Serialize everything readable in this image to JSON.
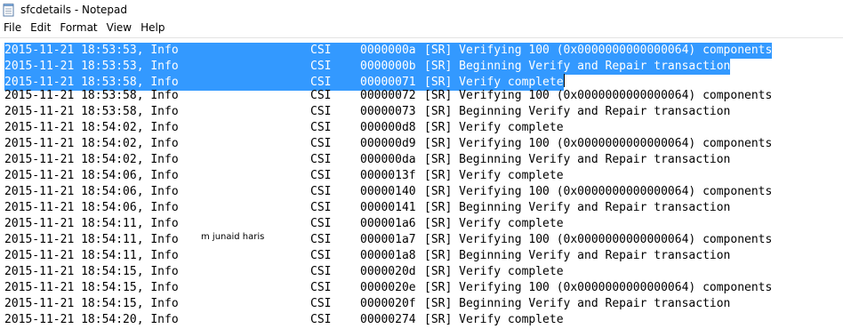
{
  "window": {
    "title": "sfcdetails - Notepad"
  },
  "menu": [
    "File",
    "Edit",
    "Format",
    "View",
    "Help"
  ],
  "watermark": "m junaid haris",
  "lines": [
    {
      "time": "2015-11-21 18:53:53, Info",
      "csi": "CSI",
      "code": "0000000a",
      "msg": "[SR] Verifying 100 (0x0000000000000064) components",
      "selected": true
    },
    {
      "time": "2015-11-21 18:53:53, Info",
      "csi": "CSI",
      "code": "0000000b",
      "msg": "[SR] Beginning Verify and Repair transaction",
      "selected": true
    },
    {
      "time": "2015-11-21 18:53:58, Info",
      "csi": "CSI",
      "code": "00000071",
      "msg": "[SR] Verify complete",
      "selected": true
    },
    {
      "time": "2015-11-21 18:53:58, Info",
      "csi": "CSI",
      "code": "00000072",
      "msg": "[SR] Verifying 100 (0x0000000000000064) components",
      "selected": false
    },
    {
      "time": "2015-11-21 18:53:58, Info",
      "csi": "CSI",
      "code": "00000073",
      "msg": "[SR] Beginning Verify and Repair transaction",
      "selected": false
    },
    {
      "time": "2015-11-21 18:54:02, Info",
      "csi": "CSI",
      "code": "000000d8",
      "msg": "[SR] Verify complete",
      "selected": false
    },
    {
      "time": "2015-11-21 18:54:02, Info",
      "csi": "CSI",
      "code": "000000d9",
      "msg": "[SR] Verifying 100 (0x0000000000000064) components",
      "selected": false
    },
    {
      "time": "2015-11-21 18:54:02, Info",
      "csi": "CSI",
      "code": "000000da",
      "msg": "[SR] Beginning Verify and Repair transaction",
      "selected": false
    },
    {
      "time": "2015-11-21 18:54:06, Info",
      "csi": "CSI",
      "code": "0000013f",
      "msg": "[SR] Verify complete",
      "selected": false
    },
    {
      "time": "2015-11-21 18:54:06, Info",
      "csi": "CSI",
      "code": "00000140",
      "msg": "[SR] Verifying 100 (0x0000000000000064) components",
      "selected": false
    },
    {
      "time": "2015-11-21 18:54:06, Info",
      "csi": "CSI",
      "code": "00000141",
      "msg": "[SR] Beginning Verify and Repair transaction",
      "selected": false
    },
    {
      "time": "2015-11-21 18:54:11, Info",
      "csi": "CSI",
      "code": "000001a6",
      "msg": "[SR] Verify complete",
      "selected": false
    },
    {
      "time": "2015-11-21 18:54:11, Info",
      "csi": "CSI",
      "code": "000001a7",
      "msg": "[SR] Verifying 100 (0x0000000000000064) components",
      "selected": false
    },
    {
      "time": "2015-11-21 18:54:11, Info",
      "csi": "CSI",
      "code": "000001a8",
      "msg": "[SR] Beginning Verify and Repair transaction",
      "selected": false
    },
    {
      "time": "2015-11-21 18:54:15, Info",
      "csi": "CSI",
      "code": "0000020d",
      "msg": "[SR] Verify complete",
      "selected": false
    },
    {
      "time": "2015-11-21 18:54:15, Info",
      "csi": "CSI",
      "code": "0000020e",
      "msg": "[SR] Verifying 100 (0x0000000000000064) components",
      "selected": false
    },
    {
      "time": "2015-11-21 18:54:15, Info",
      "csi": "CSI",
      "code": "0000020f",
      "msg": "[SR] Beginning Verify and Repair transaction",
      "selected": false
    },
    {
      "time": "2015-11-21 18:54:20, Info",
      "csi": "CSI",
      "code": "00000274",
      "msg": "[SR] Verify complete",
      "selected": false
    }
  ],
  "colors": {
    "selection": "#3399ff",
    "selection_text": "#ffffff",
    "text": "#000000"
  }
}
